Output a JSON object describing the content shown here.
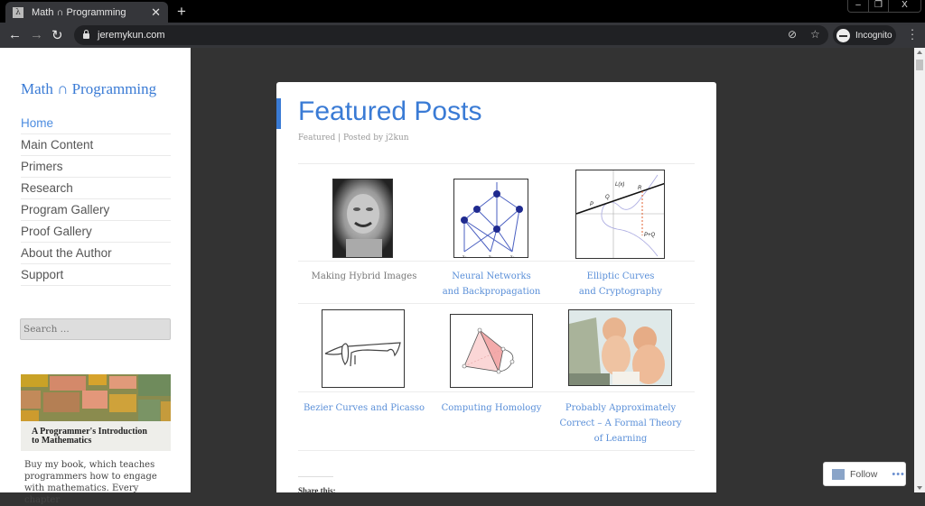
{
  "browser": {
    "tab_title": "Math ∩ Programming",
    "tab_favicon": "λ",
    "url": "jeremykun.com",
    "incognito_label": "Incognito",
    "window_controls": [
      "–",
      "❐",
      "X"
    ]
  },
  "sidebar": {
    "site_title": "Math ∩ Programming",
    "nav": [
      {
        "label": "Home",
        "active": true
      },
      {
        "label": "Main Content"
      },
      {
        "label": "Primers"
      },
      {
        "label": "Research"
      },
      {
        "label": "Program Gallery"
      },
      {
        "label": "Proof Gallery"
      },
      {
        "label": "About the Author"
      },
      {
        "label": "Support"
      }
    ],
    "search_placeholder": "Search ...",
    "book": {
      "title_line1": "A Programmer's Introduction",
      "title_line2": "to Mathematics",
      "description": "Buy my book, which teaches programmers how to engage with mathematics. Every chapter"
    }
  },
  "article": {
    "title": "Featured Posts",
    "meta": "Featured | Posted by j2kun",
    "posts": [
      {
        "caption_lines": [
          "Making Hybrid Images"
        ],
        "thumb": "hybrid-image-portrait",
        "link": false
      },
      {
        "caption_lines": [
          "Neural Networks",
          "and Backpropagation"
        ],
        "thumb": "neural-network-diagram",
        "link": true
      },
      {
        "caption_lines": [
          "Elliptic Curves",
          "and Cryptography"
        ],
        "thumb": "elliptic-curve-plot",
        "link": true
      },
      {
        "caption_lines": [
          "Bezier Curves and Picasso"
        ],
        "thumb": "picasso-dog-drawing",
        "link": true
      },
      {
        "caption_lines": [
          "Computing Homology"
        ],
        "thumb": "simplicial-complex",
        "link": true
      },
      {
        "caption_lines": [
          "Probably Approximately",
          "Correct – A Formal Theory",
          "of Learning"
        ],
        "thumb": "babies-computer-photo",
        "link": true
      }
    ],
    "elliptic_labels": {
      "line": "L(x)",
      "p": "P",
      "q": "Q",
      "r": "R",
      "sum": "P+Q"
    },
    "nn_labels": [
      "x₀",
      "x₁",
      "x₂"
    ],
    "share_label": "Share this:"
  },
  "follow": {
    "label": "Follow",
    "more": "•••"
  }
}
